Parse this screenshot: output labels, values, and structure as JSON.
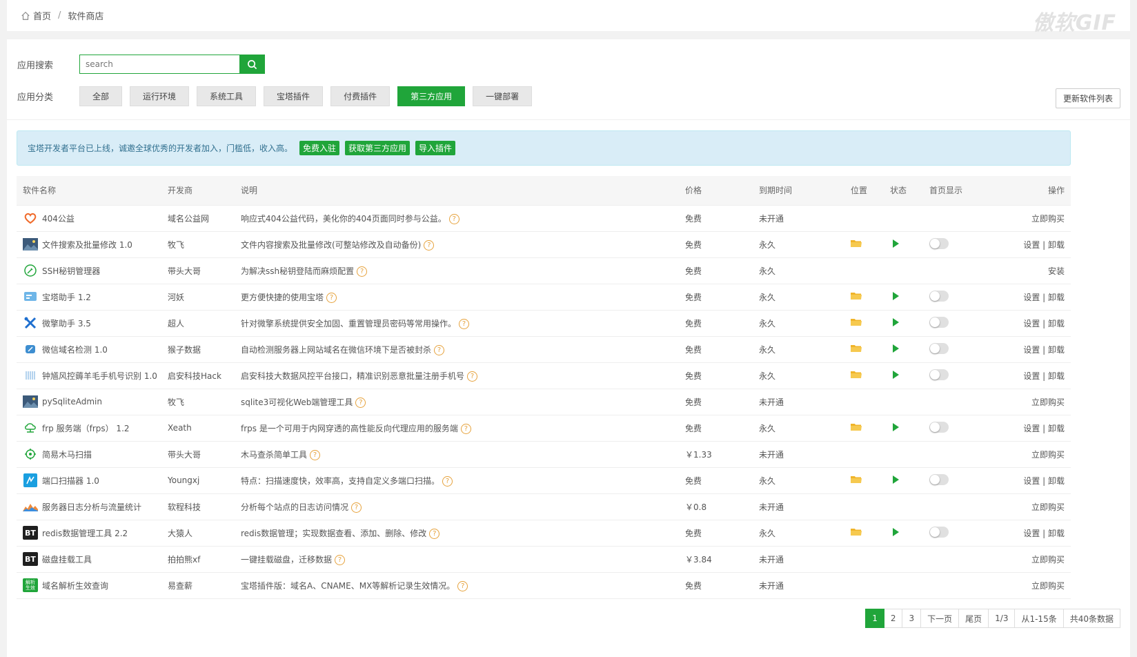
{
  "breadcrumb": {
    "home": "首页",
    "separator": "/",
    "current": "软件商店"
  },
  "watermark": "傲软GIF",
  "search": {
    "label": "应用搜索",
    "placeholder": "search"
  },
  "categories": {
    "label": "应用分类",
    "items": [
      "全部",
      "运行环境",
      "系统工具",
      "宝塔插件",
      "付费插件",
      "第三方应用",
      "一键部署"
    ],
    "active_index": 5,
    "refresh_label": "更新软件列表"
  },
  "notice": {
    "text": "宝塔开发者平台已上线，诚邀全球优秀的开发者加入，门槛低，收入高。",
    "buttons": [
      "免费入驻",
      "获取第三方应用",
      "导入插件"
    ]
  },
  "table": {
    "headers": [
      "软件名称",
      "开发商",
      "说明",
      "价格",
      "到期时间",
      "位置",
      "状态",
      "首页显示",
      "操作"
    ],
    "rows": [
      {
        "icon": "heart-icon",
        "name": "404公益",
        "dev": "域名公益网",
        "desc": "响应式404公益代码，美化你的404页面同时参与公益。",
        "price": "免费",
        "expire": "未开通",
        "installed": false,
        "action": "立即购买"
      },
      {
        "icon": "image-icon",
        "name": "文件搜索及批量修改 1.0",
        "dev": "牧飞",
        "desc": "文件内容搜索及批量修改(可整站修改及自动备份)",
        "price": "免费",
        "expire": "永久",
        "installed": true,
        "action": "设置 | 卸载"
      },
      {
        "icon": "key-icon",
        "name": "SSH秘钥管理器",
        "dev": "带头大哥",
        "desc": "为解决ssh秘钥登陆而麻烦配置",
        "price": "免费",
        "expire": "永久",
        "installed": false,
        "action": "安装"
      },
      {
        "icon": "assistant-icon",
        "name": "宝塔助手 1.2",
        "dev": "河妖",
        "desc": "更方便快捷的使用宝塔",
        "price": "免费",
        "expire": "永久",
        "installed": true,
        "action": "设置 | 卸载"
      },
      {
        "icon": "tools-icon",
        "name": "微擎助手 3.5",
        "dev": "超人",
        "desc": "针对微擎系统提供安全加固、重置管理员密码等常用操作。",
        "price": "免费",
        "expire": "永久",
        "installed": true,
        "action": "设置 | 卸载"
      },
      {
        "icon": "wechat-icon",
        "name": "微信域名检测 1.0",
        "dev": "猴子数据",
        "desc": "自动检测服务器上网站域名在微信环境下是否被封杀",
        "price": "免费",
        "expire": "永久",
        "installed": true,
        "action": "设置 | 卸载"
      },
      {
        "icon": "barcode-icon",
        "name": "钟馗风控薅羊毛手机号识别 1.0",
        "dev": "启安科技Hack",
        "desc": "启安科技大数据风控平台接口，精准识别恶意批量注册手机号",
        "price": "免费",
        "expire": "永久",
        "installed": true,
        "action": "设置 | 卸载"
      },
      {
        "icon": "image-icon",
        "name": "pySqliteAdmin",
        "dev": "牧飞",
        "desc": "sqlite3可视化Web端管理工具",
        "price": "免费",
        "expire": "未开通",
        "installed": false,
        "action": "立即购买"
      },
      {
        "icon": "cloud-icon",
        "name": "frp 服务端（frps） 1.2",
        "dev": "Xeath",
        "desc": "frps 是一个可用于内网穿透的高性能反向代理应用的服务端",
        "price": "免费",
        "expire": "永久",
        "installed": true,
        "action": "设置 | 卸载"
      },
      {
        "icon": "target-icon",
        "name": "简易木马扫描",
        "dev": "带头大哥",
        "desc": "木马查杀简单工具",
        "price": "￥1.33",
        "price_paid": true,
        "expire": "未开通",
        "installed": false,
        "action": "立即购买"
      },
      {
        "icon": "port-icon",
        "name": "端口扫描器 1.0",
        "dev": "Youngxj",
        "desc": "特点：扫描速度快，效率高，支持自定义多端口扫描。",
        "price": "免费",
        "expire": "永久",
        "installed": true,
        "action": "设置 | 卸载"
      },
      {
        "icon": "chart-icon",
        "name": "服务器日志分析与流量统计",
        "dev": "软程科技",
        "desc": "分析每个站点的日志访问情况",
        "price": "￥0.8",
        "price_paid": true,
        "expire": "未开通",
        "installed": false,
        "action": "立即购买"
      },
      {
        "icon": "bt-icon",
        "name": "redis数据管理工具 2.2",
        "dev": "大猿人",
        "desc": "redis数据管理；实现数据查看、添加、删除、修改",
        "price": "免费",
        "expire": "永久",
        "installed": true,
        "action": "设置 | 卸载"
      },
      {
        "icon": "bt-icon",
        "name": "磁盘挂载工具",
        "dev": "拍拍熊xf",
        "desc": "一键挂载磁盘，迁移数据",
        "price": "￥3.84",
        "price_paid": true,
        "expire": "未开通",
        "installed": false,
        "action": "立即购买"
      },
      {
        "icon": "dns-icon",
        "name": "域名解析生效查询",
        "dev": "易查薪",
        "desc": "宝塔插件版：域名A、CNAME、MX等解析记录生效情况。",
        "price": "免费",
        "expire": "未开通",
        "installed": false,
        "action": "立即购买"
      }
    ]
  },
  "pager": {
    "pages": [
      "1",
      "2",
      "3"
    ],
    "next": "下一页",
    "last": "尾页",
    "ratio": "1/3",
    "range": "从1-15条",
    "total": "共40条数据"
  },
  "colors": {
    "accent": "#20a53a",
    "paid": "#f0ad4e",
    "help": "#e6a23c"
  },
  "help_glyph": "?",
  "bt_text": "BT",
  "dns_text": "解析生效"
}
